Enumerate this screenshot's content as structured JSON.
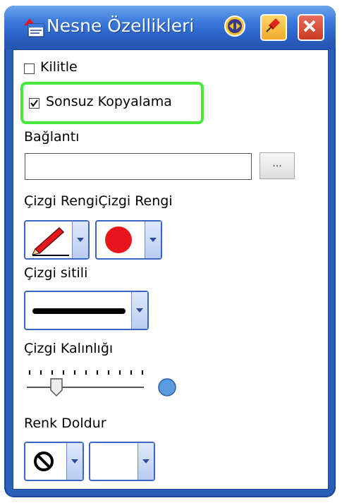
{
  "window": {
    "title": "Nesne Özellikleri",
    "icons": {
      "app": "properties-icon",
      "nav": "navigate-icon",
      "pin": "pin-icon",
      "close": "close-icon"
    }
  },
  "lock": {
    "label": "Kilitle",
    "checked": false
  },
  "infinite_copy": {
    "label": "Sonsuz Kopyalama",
    "checked": true
  },
  "link": {
    "label": "Bağlantı",
    "value": "",
    "browse_label": "..."
  },
  "line_color": {
    "label": "Çizgi RengiÇizgi Rengi",
    "pen_icon": "pen-icon",
    "color": "#e8161c"
  },
  "line_style": {
    "label": "Çizgi sitili"
  },
  "line_width": {
    "label": "Çizgi Kalınlığı",
    "level": 0.25
  },
  "fill": {
    "label": "Renk Doldur",
    "none_icon": "no-fill-icon",
    "color": "#ffffff"
  },
  "colors": {
    "title_bar": "#2a61c4",
    "highlight": "#46e83c",
    "dropdown_border": "#3a66c2",
    "slider_knob": "#5b9be0"
  }
}
